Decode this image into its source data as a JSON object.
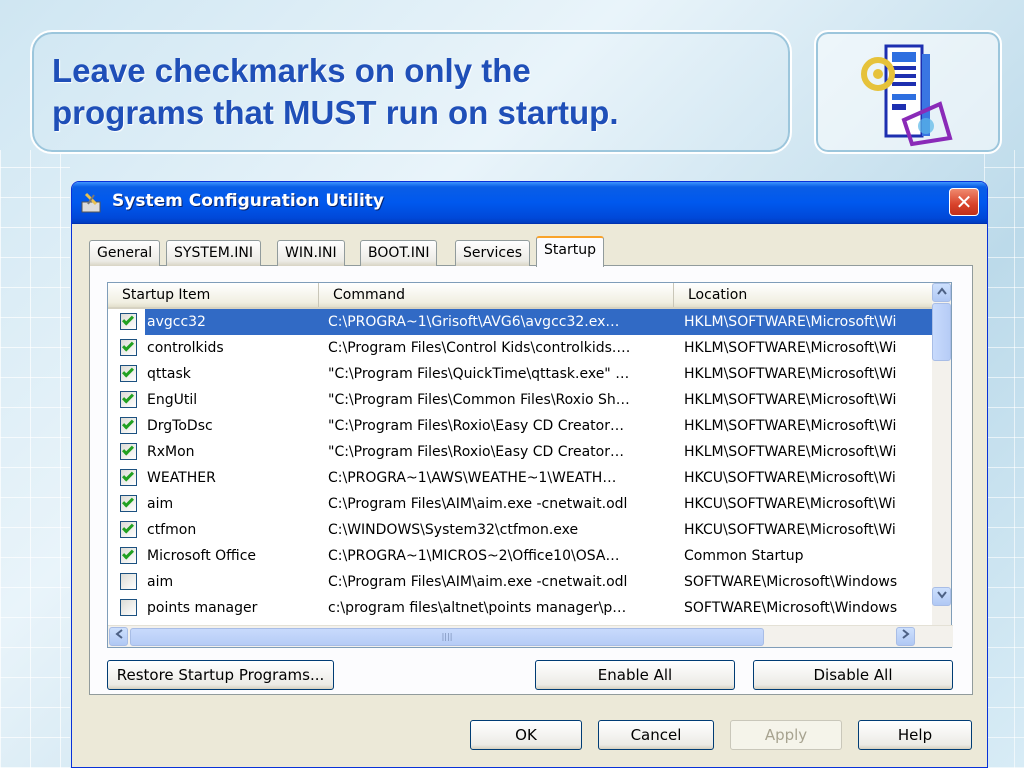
{
  "slide": {
    "title_line1": "Leave checkmarks on only the",
    "title_line2": "programs that MUST run on startup."
  },
  "dialog": {
    "title": "System Configuration Utility",
    "close_glyph": "✕",
    "tabs": [
      "General",
      "SYSTEM.INI",
      "WIN.INI",
      "BOOT.INI",
      "Services",
      "Startup"
    ],
    "active_tab": "Startup",
    "columns": [
      "Startup Item",
      "Command",
      "Location"
    ],
    "rows": [
      {
        "checked": true,
        "item": "avgcc32",
        "command": "C:\\PROGRA~1\\Grisoft\\AVG6\\avgcc32.ex…",
        "location": "HKLM\\SOFTWARE\\Microsoft\\Wi",
        "selected": true
      },
      {
        "checked": true,
        "item": "controlkids",
        "command": "C:\\Program Files\\Control Kids\\controlkids.…",
        "location": "HKLM\\SOFTWARE\\Microsoft\\Wi"
      },
      {
        "checked": true,
        "item": "qttask",
        "command": "\"C:\\Program Files\\QuickTime\\qttask.exe\" …",
        "location": "HKLM\\SOFTWARE\\Microsoft\\Wi"
      },
      {
        "checked": true,
        "item": "EngUtil",
        "command": "\"C:\\Program Files\\Common Files\\Roxio Sh…",
        "location": "HKLM\\SOFTWARE\\Microsoft\\Wi"
      },
      {
        "checked": true,
        "item": "DrgToDsc",
        "command": "\"C:\\Program Files\\Roxio\\Easy CD Creator…",
        "location": "HKLM\\SOFTWARE\\Microsoft\\Wi"
      },
      {
        "checked": true,
        "item": "RxMon",
        "command": "\"C:\\Program Files\\Roxio\\Easy CD Creator…",
        "location": "HKLM\\SOFTWARE\\Microsoft\\Wi"
      },
      {
        "checked": true,
        "item": "WEATHER",
        "command": "C:\\PROGRA~1\\AWS\\WEATHE~1\\WEATH…",
        "location": "HKCU\\SOFTWARE\\Microsoft\\Wi"
      },
      {
        "checked": true,
        "item": "aim",
        "command": "C:\\Program Files\\AIM\\aim.exe -cnetwait.odl",
        "location": "HKCU\\SOFTWARE\\Microsoft\\Wi"
      },
      {
        "checked": true,
        "item": "ctfmon",
        "command": "C:\\WINDOWS\\System32\\ctfmon.exe",
        "location": "HKCU\\SOFTWARE\\Microsoft\\Wi"
      },
      {
        "checked": true,
        "item": "Microsoft Office",
        "command": "C:\\PROGRA~1\\MICROS~2\\Office10\\OSA…",
        "location": "Common Startup"
      },
      {
        "checked": false,
        "item": "aim",
        "command": "C:\\Program Files\\AIM\\aim.exe -cnetwait.odl",
        "location": "SOFTWARE\\Microsoft\\Windows"
      },
      {
        "checked": false,
        "item": "points manager",
        "command": "c:\\program files\\altnet\\points manager\\p…",
        "location": "SOFTWARE\\Microsoft\\Windows"
      }
    ],
    "restore_label": "Restore Startup Programs...",
    "enable_all_label": "Enable All",
    "disable_all_label": "Disable All",
    "ok_label": "OK",
    "cancel_label": "Cancel",
    "apply_label": "Apply",
    "help_label": "Help",
    "colors": {
      "titlebar": "#0058ee",
      "selection": "#316ac5",
      "check": "#21a121",
      "close": "#d8422a"
    }
  }
}
